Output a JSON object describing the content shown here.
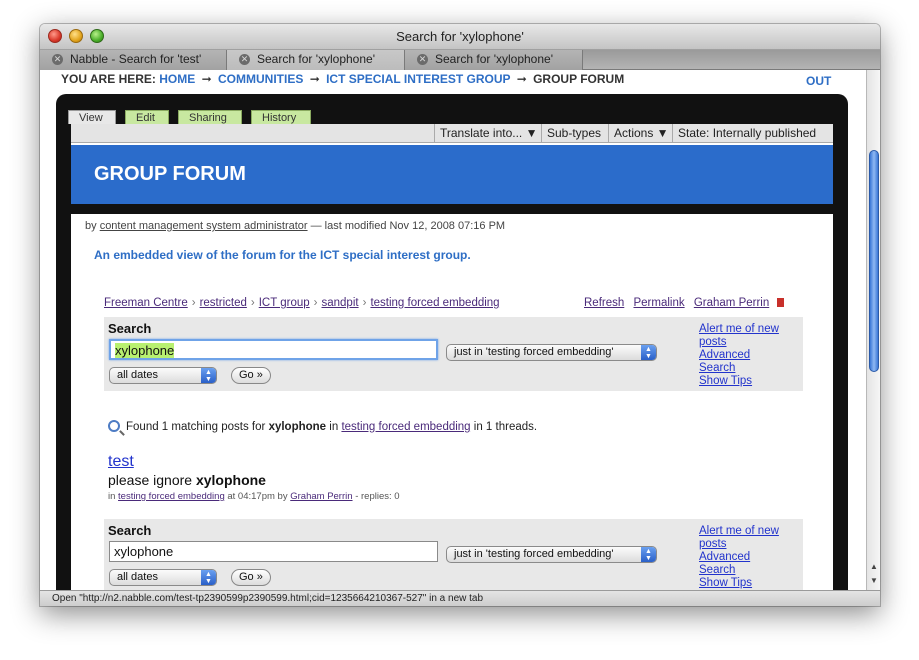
{
  "window": {
    "title": "Search for 'xylophone'"
  },
  "tabs": [
    {
      "label": "Nabble - Search for 'test'"
    },
    {
      "label": "Search for 'xylophone'"
    },
    {
      "label": "Search for 'xylophone'"
    }
  ],
  "breadcrumb": {
    "prefix": "YOU ARE HERE:",
    "items": [
      "HOME",
      "COMMUNITIES",
      "ICT SPECIAL INTEREST GROUP",
      "GROUP FORUM"
    ],
    "arrow": "➞",
    "out": "OUT"
  },
  "view_tabs": [
    "View",
    "Edit",
    "Sharing",
    "History"
  ],
  "action_menus": [
    "Translate into... ▼",
    "Sub-types",
    "Actions ▼",
    "State: Internally published ▼"
  ],
  "page": {
    "title": "GROUP FORUM",
    "byline_prefix": "by",
    "author": "content management system administrator",
    "modified": "— last modified Nov 12, 2008 07:16 PM",
    "description": "An embedded view of the forum for the ICT special interest group."
  },
  "forum_breadcrumb": [
    "Freeman Centre",
    "restricted",
    "ICT group",
    "sandpit",
    "testing forced embedding"
  ],
  "forum_separator": "›",
  "forum_links": [
    "Refresh",
    "Permalink",
    "Graham Perrin"
  ],
  "search": {
    "label": "Search",
    "query": "xylophone",
    "scope": "just in 'testing forced embedding'",
    "dates": "all dates",
    "go": "Go »",
    "side_links": [
      "Alert me of new",
      "posts",
      "Advanced",
      "Search",
      "Show Tips"
    ]
  },
  "results": {
    "found_prefix": "Found 1 matching posts for",
    "query": "xylophone",
    "in": "in",
    "forum": "testing forced embedding",
    "suffix": "in 1 threads.",
    "item": {
      "title": "test",
      "snippet_prefix": "please ignore",
      "snippet_term": "xylophone",
      "meta_in": "in",
      "meta_forum": "testing forced embedding",
      "meta_time": "at 04:17pm by",
      "meta_author": "Graham Perrin",
      "meta_replies": "- replies: 0"
    }
  },
  "statusbar": {
    "text": "Open \"http://n2.nabble.com/test-tp2390599p2390599.html;cid=1235664210367-527\" in a new tab"
  },
  "colors": {
    "banner": "#2b6ccb",
    "link": "#2e6ec5",
    "tab_green": "#c8e8a0"
  }
}
